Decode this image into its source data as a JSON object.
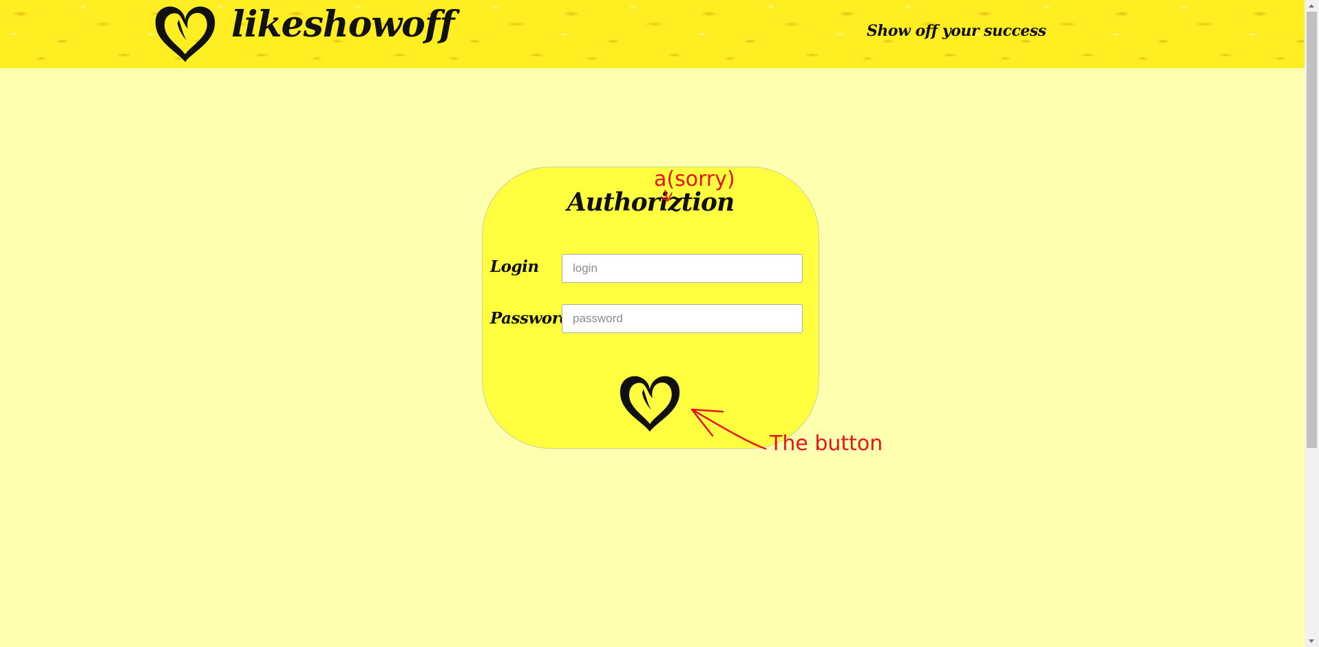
{
  "header": {
    "brand": "likeshowoff",
    "tagline": "Show off your success",
    "logo_icon": "heart-icon"
  },
  "auth_form": {
    "title": "Authoriztion",
    "login_label": "Login",
    "login_placeholder": "login",
    "login_value": "",
    "password_label": "Password",
    "password_placeholder": "password",
    "password_value": "",
    "submit_icon": "heart-icon"
  },
  "annotations": {
    "typo_note": "a(sorry)",
    "button_note": "The button",
    "color": "#e8141c"
  },
  "colors": {
    "page_background": "#ffffb0",
    "card_background": "#ffff3f",
    "header_background": "#ffee22"
  }
}
